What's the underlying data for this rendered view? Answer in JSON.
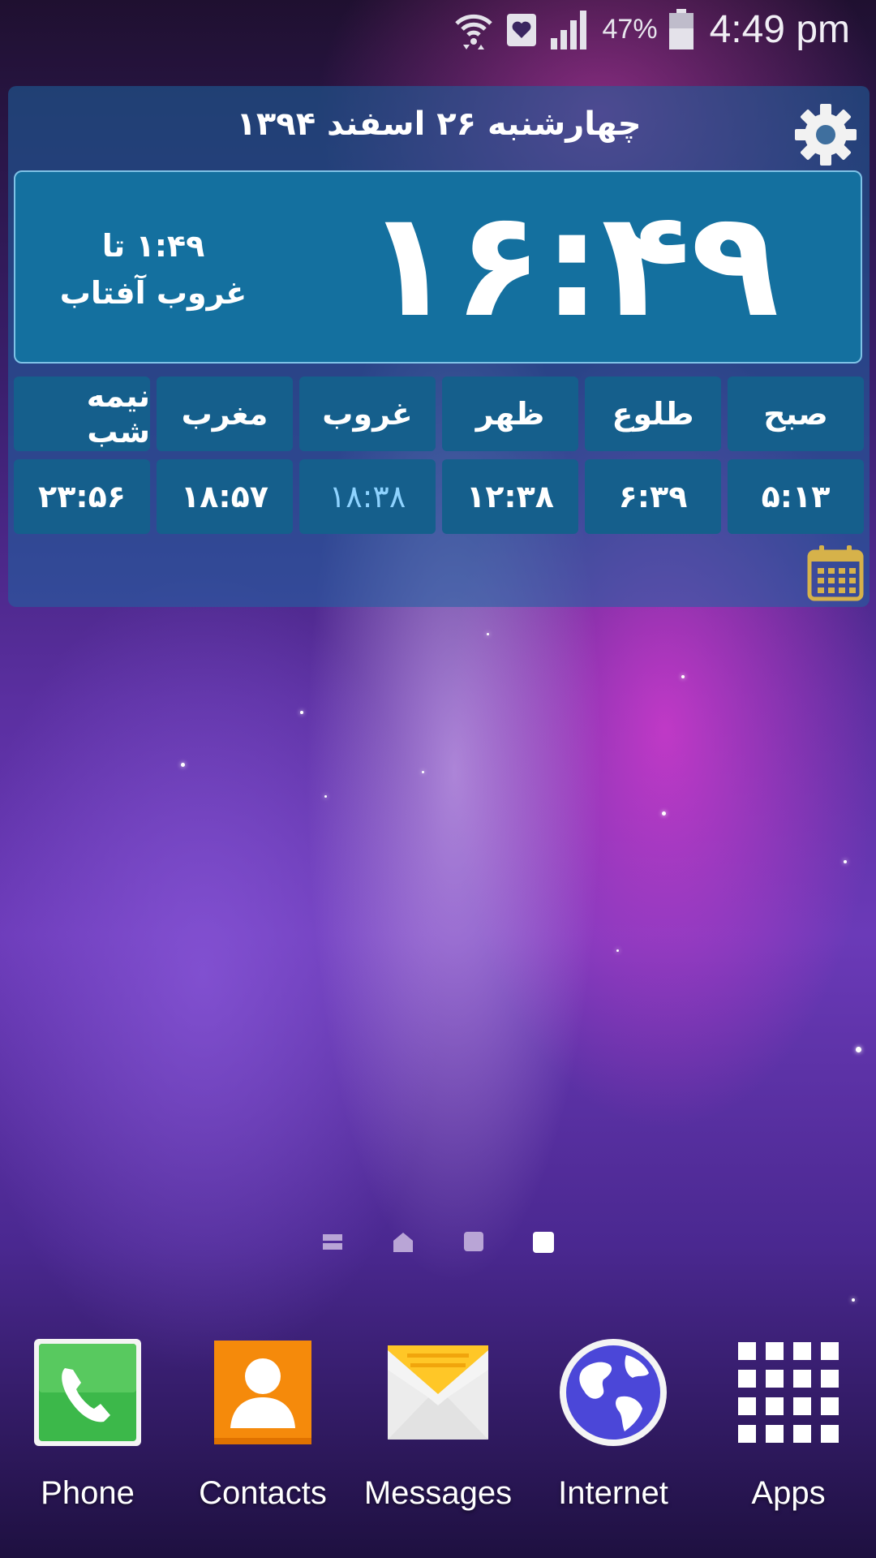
{
  "status_bar": {
    "icons": [
      "wifi-icon",
      "heart-notification-icon",
      "signal-icon",
      "battery-icon"
    ],
    "battery_percent": "47%",
    "time": "4:49 pm"
  },
  "widget": {
    "date": "چهارشنبه ۲۶  اسفند  ۱۳۹۴",
    "current_time": "۱۶:۴۹",
    "countdown": "۱:۴۹ تا",
    "countdown_label": "غروب آفتاب",
    "prayers": [
      {
        "name": "صبح",
        "time": "۵:۱۳",
        "highlight": false
      },
      {
        "name": "طلوع",
        "time": "۶:۳۹",
        "highlight": false
      },
      {
        "name": "ظهر",
        "time": "۱۲:۳۸",
        "highlight": false
      },
      {
        "name": "غروب",
        "time": "۱۸:۳۸",
        "highlight": true
      },
      {
        "name": "مغرب",
        "time": "۱۸:۵۷",
        "highlight": false
      },
      {
        "name": "نیمه شب",
        "time": "۲۳:۵۶",
        "highlight": false
      }
    ],
    "accent_color": "#14709f",
    "highlight_color": "#8ed3ff"
  },
  "dock": {
    "items": [
      {
        "label": "Phone",
        "icon": "phone-icon"
      },
      {
        "label": "Contacts",
        "icon": "contacts-icon"
      },
      {
        "label": "Messages",
        "icon": "messages-icon"
      },
      {
        "label": "Internet",
        "icon": "globe-icon"
      },
      {
        "label": "Apps",
        "icon": "apps-grid-icon"
      }
    ]
  }
}
